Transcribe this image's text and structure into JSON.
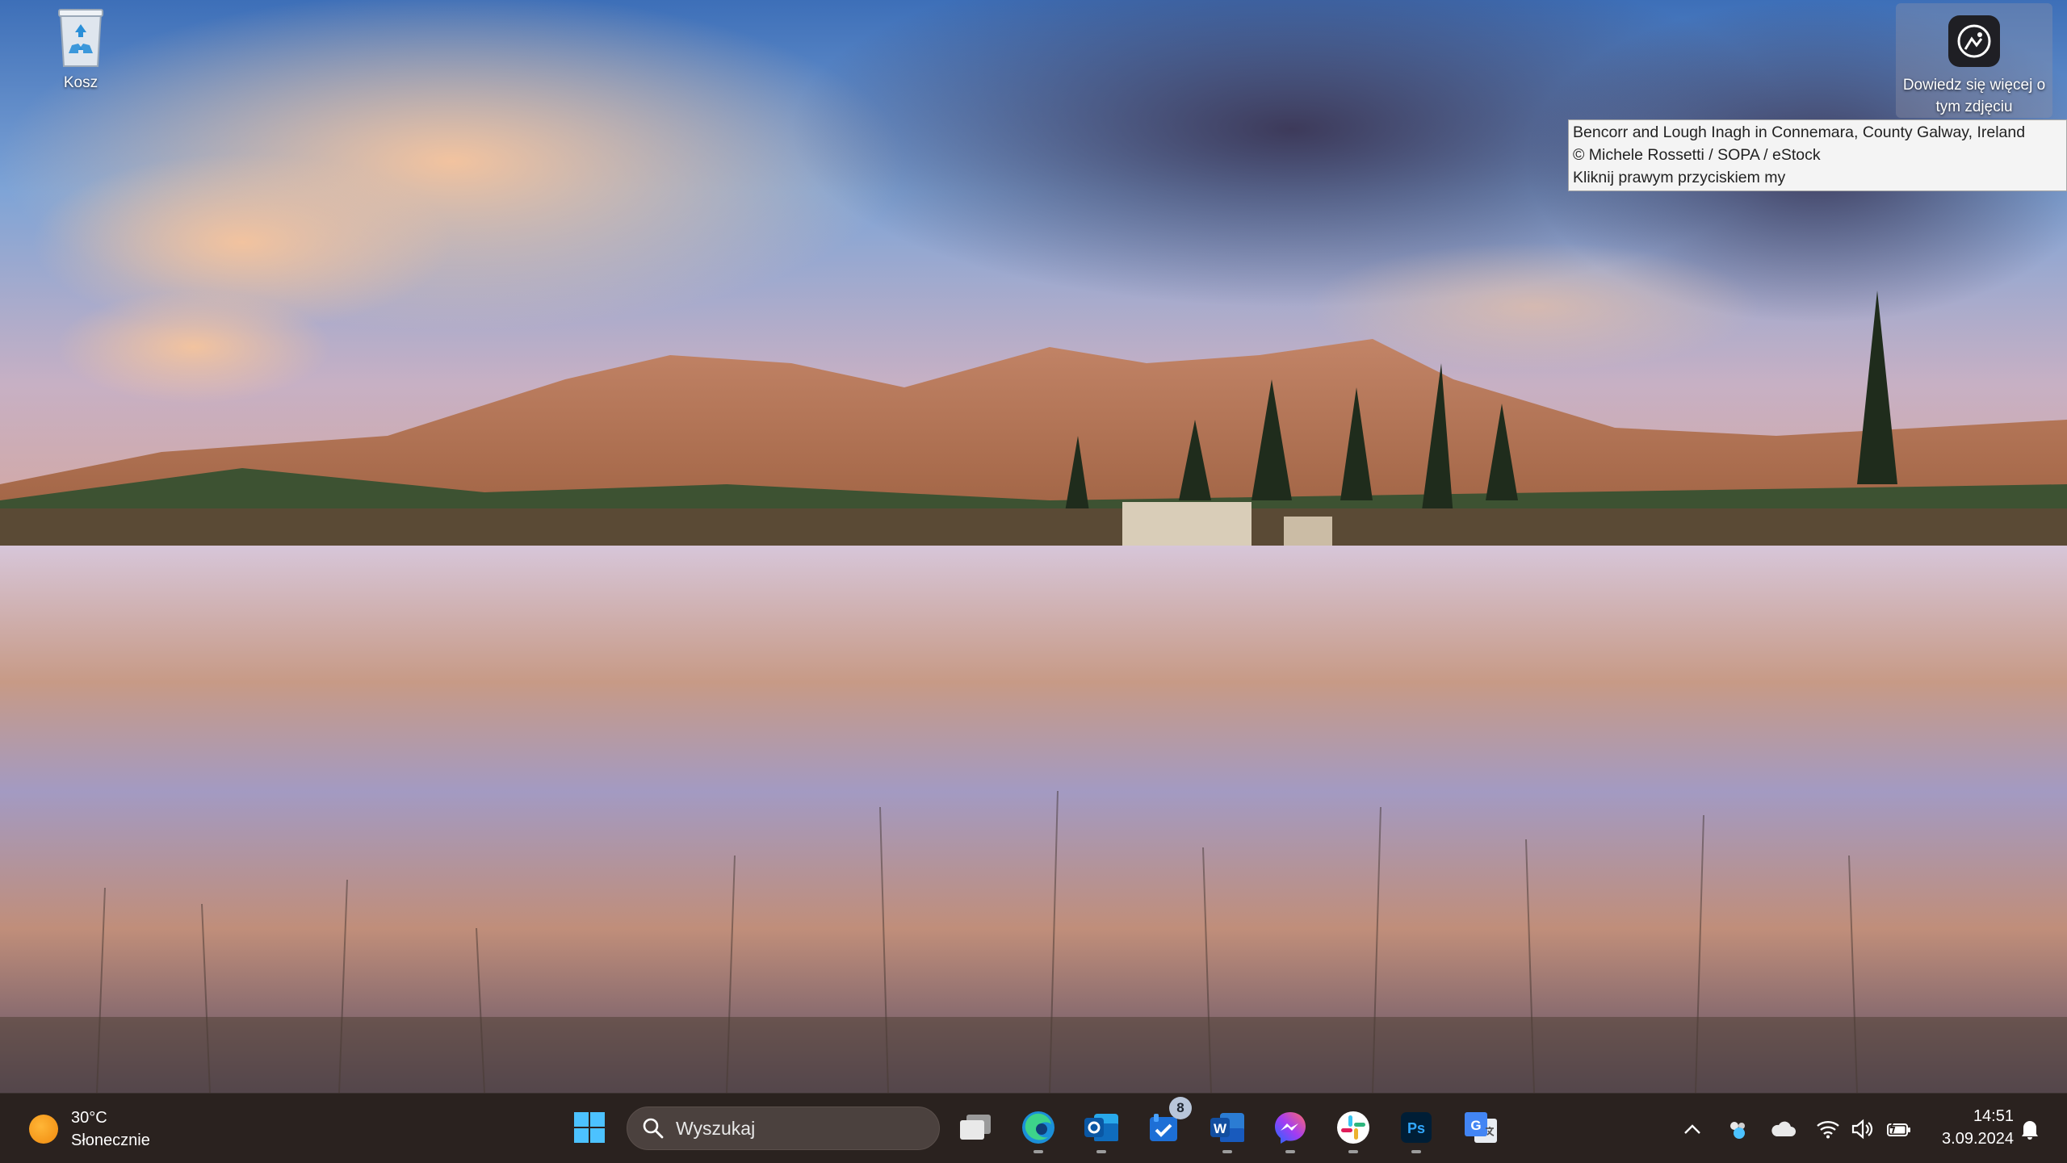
{
  "desktop": {
    "icons": [
      {
        "label": "Kosz",
        "icon": "recycle-bin-icon"
      }
    ],
    "spotlight": {
      "label": "Dowiedz się więcej o tym zdjęciu",
      "icon": "camera-info-icon"
    },
    "tooltip": {
      "line1": "Bencorr and Lough Inagh in Connemara, County Galway, Ireland",
      "line2": "© Michele Rossetti / SOPA / eStock",
      "line3": "Kliknij prawym przyciskiem my"
    }
  },
  "taskbar": {
    "weather": {
      "temp": "30°C",
      "condition": "Słonecznie",
      "icon": "sun-icon"
    },
    "search_placeholder": "Wyszukaj",
    "apps": [
      {
        "name": "Start",
        "icon": "windows-logo-icon"
      },
      {
        "name": "Task View",
        "icon": "task-view-icon"
      },
      {
        "name": "Microsoft Edge",
        "icon": "edge-icon"
      },
      {
        "name": "Outlook",
        "icon": "outlook-icon"
      },
      {
        "name": "Microsoft To Do",
        "icon": "todo-icon",
        "badge": "8"
      },
      {
        "name": "Word",
        "icon": "word-icon",
        "text": "W"
      },
      {
        "name": "Messenger",
        "icon": "messenger-icon"
      },
      {
        "name": "Slack",
        "icon": "slack-icon"
      },
      {
        "name": "Photoshop",
        "icon": "photoshop-icon",
        "text": "Ps"
      },
      {
        "name": "Google Translate",
        "icon": "translate-icon",
        "text": "G"
      }
    ],
    "clock": {
      "time": "14:51",
      "date": "3.09.2024"
    }
  },
  "colors": {
    "taskbar_bg": "#2a221f",
    "search_bg": "#4b413e",
    "tooltip_bg": "#f4f4f4",
    "accent_blue": "#0f6cbd"
  }
}
